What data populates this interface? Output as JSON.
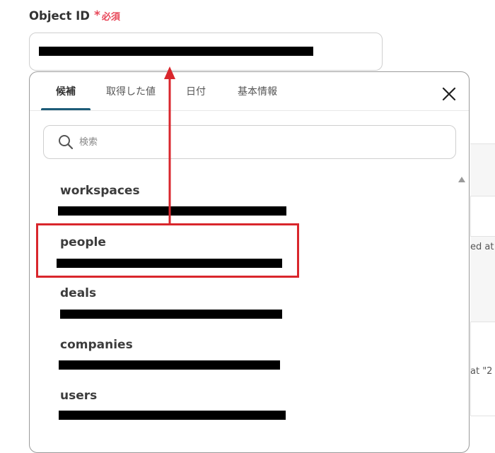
{
  "field": {
    "label": "Object ID",
    "required_star": "*",
    "required_text": "必須"
  },
  "tabs": [
    {
      "label": "候補",
      "active": true
    },
    {
      "label": "取得した値",
      "active": false
    },
    {
      "label": "日付",
      "active": false
    },
    {
      "label": "基本情報",
      "active": false
    }
  ],
  "search": {
    "placeholder": "検索"
  },
  "items": [
    {
      "name": "workspaces"
    },
    {
      "name": "people"
    },
    {
      "name": "deals"
    },
    {
      "name": "companies"
    },
    {
      "name": "users"
    }
  ],
  "background": {
    "text_1": "ed at",
    "text_2": "at \"2"
  },
  "colors": {
    "accent_tab": "#1d5c78",
    "required": "#e8485a",
    "annotation_red": "#d9262c"
  },
  "icons": {
    "close": "close-icon",
    "search": "search-icon",
    "scroll_up": "triangle-up-icon"
  }
}
